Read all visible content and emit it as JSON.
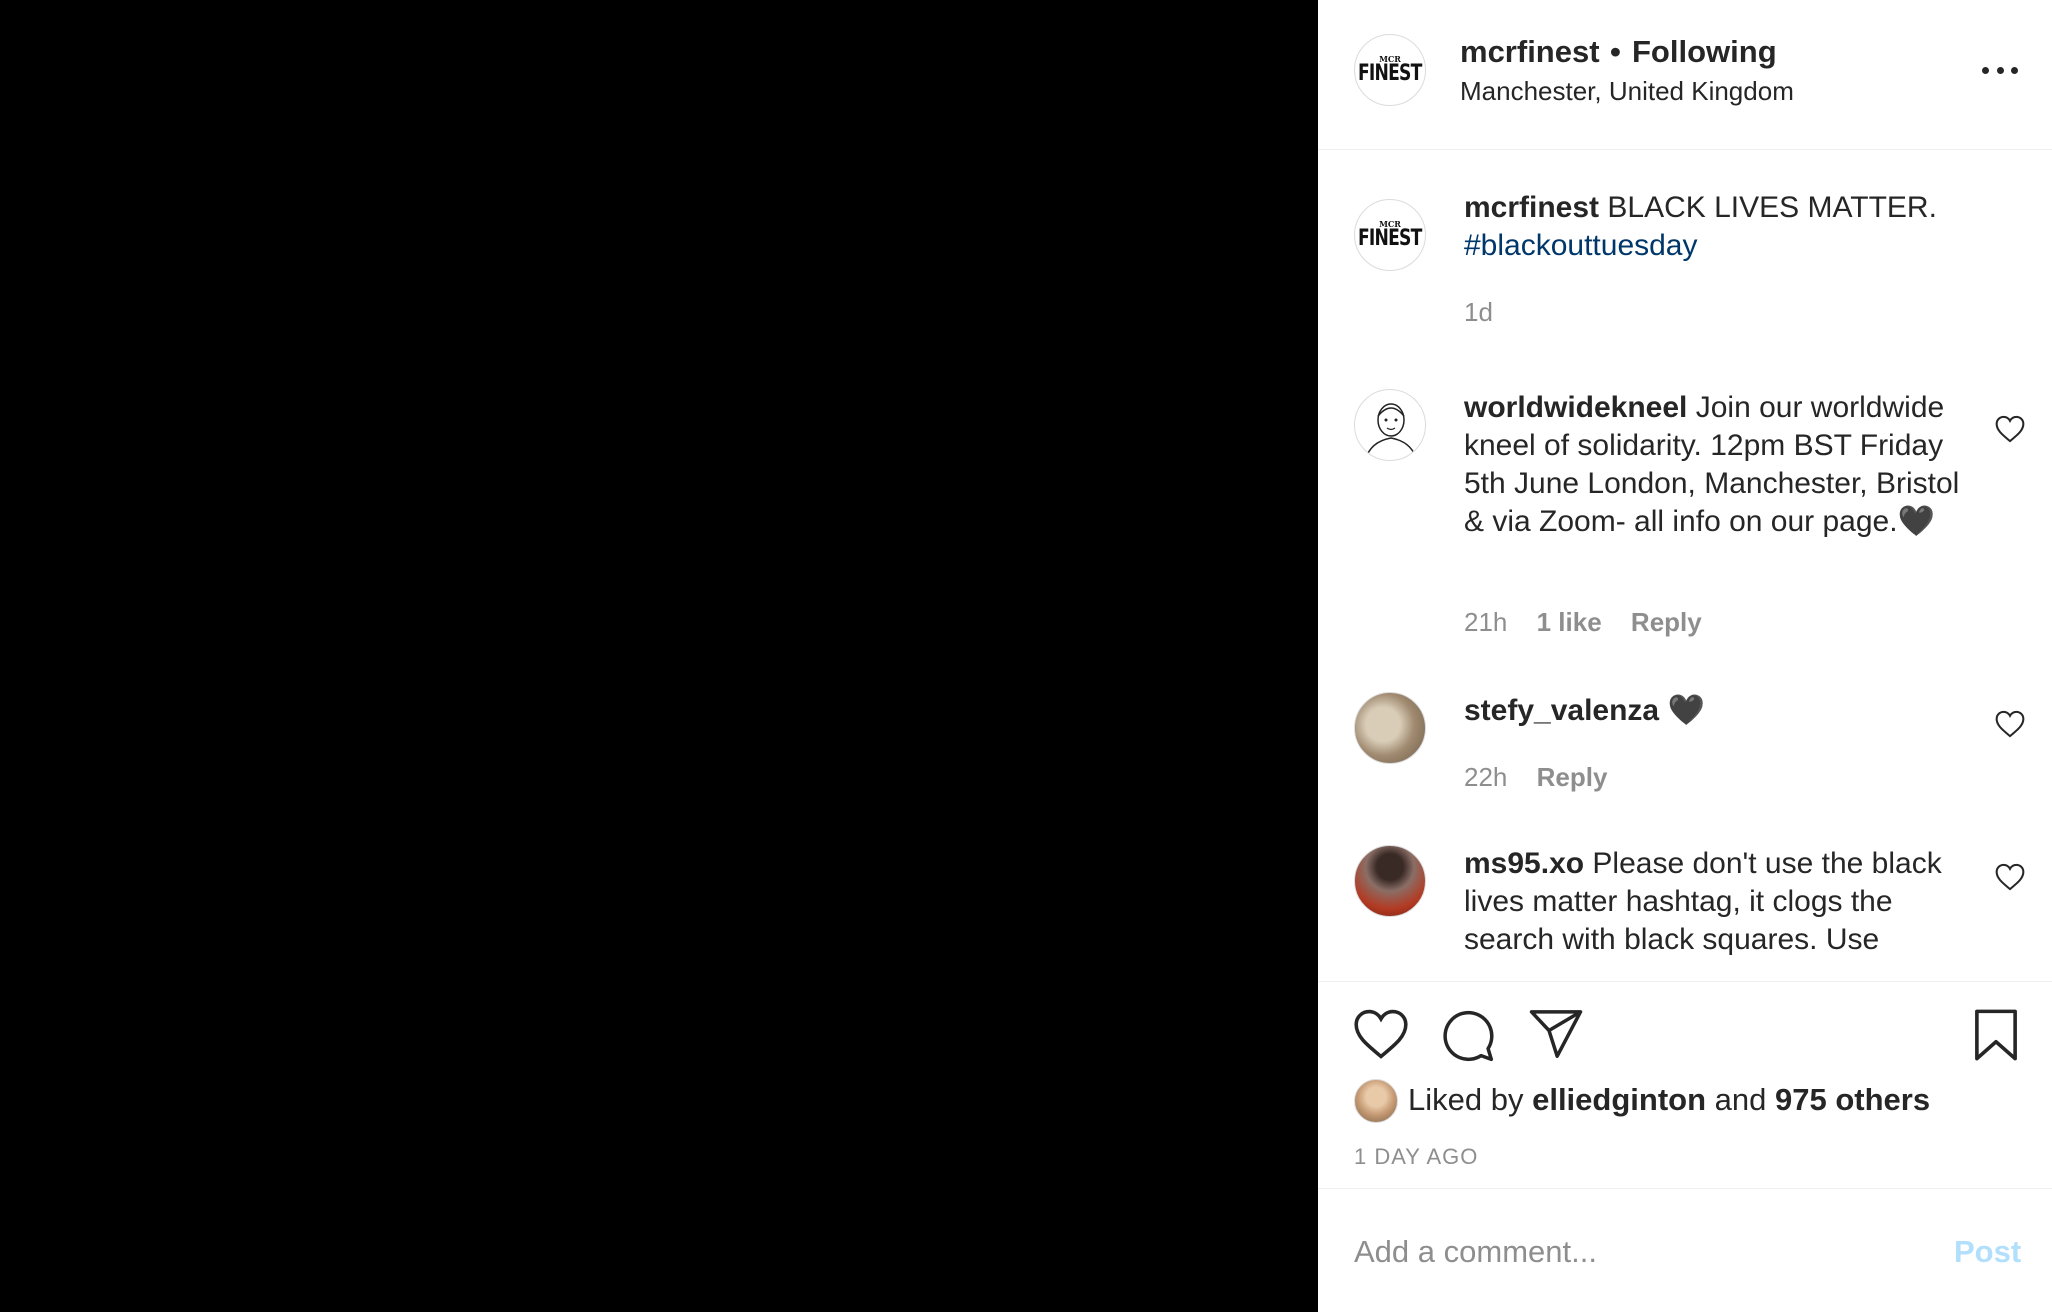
{
  "header": {
    "username": "mcrfinest",
    "separator": "•",
    "follow_status": "Following",
    "location": "Manchester, United Kingdom",
    "avatar_logo_small": "MCR",
    "avatar_logo_big": "FINEST",
    "more_icon": "more-horizontal-icon"
  },
  "caption": {
    "username": "mcrfinest",
    "text": "BLACK LIVES MATTER.",
    "hashtag": "#blackouttuesday",
    "time": "1d"
  },
  "comments": [
    {
      "username": "worldwidekneel",
      "text": "Join our worldwide kneel of solidarity. 12pm BST Friday 5th June London, Manchester, Bristol & via Zoom- all info on our page.🖤",
      "time": "21h",
      "likes": "1 like",
      "reply": "Reply"
    },
    {
      "username": "stefy_valenza",
      "text": "🖤",
      "time": "22h",
      "reply": "Reply"
    },
    {
      "username": "ms95.xo",
      "text": "Please don't use the black lives matter hashtag, it clogs the search with black squares. Use"
    }
  ],
  "actions": {
    "like_icon": "heart-icon",
    "comment_icon": "speech-bubble-icon",
    "share_icon": "paper-plane-icon",
    "save_icon": "bookmark-icon"
  },
  "likes": {
    "prefix": "Liked by",
    "user": "elliedginton",
    "conjunction": "and",
    "others": "975 others"
  },
  "post_time": "1 DAY AGO",
  "add_comment": {
    "placeholder": "Add a comment...",
    "post_label": "Post"
  },
  "colors": {
    "hashtag": "#00376b",
    "muted": "#8e8e8e",
    "post_button": "#b2dffc"
  }
}
